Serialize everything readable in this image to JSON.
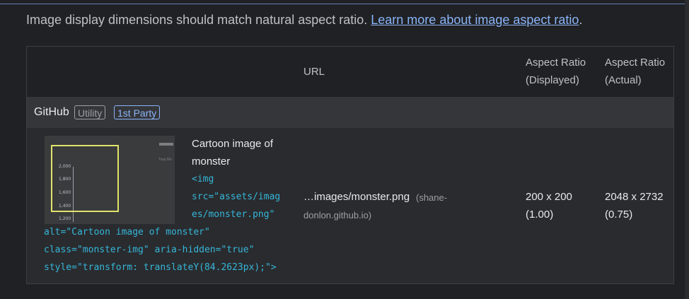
{
  "description": {
    "text": "Image display dimensions should match natural aspect ratio. ",
    "link": "Learn more about image aspect ratio",
    "suffix": "."
  },
  "table": {
    "headers": {
      "url": "URL",
      "displayed_line1": "Aspect Ratio",
      "displayed_line2": "(Displayed)",
      "actual_line1": "Aspect Ratio",
      "actual_line2": "(Actual)"
    },
    "group": {
      "entity": "GitHub",
      "badge_category": "Utility",
      "badge_party": "1st Party"
    },
    "rows": [
      {
        "thumbnail_ticks": [
          "2,000",
          "1,800",
          "1,600",
          "1,400",
          "1,200"
        ],
        "thumbnail_corner_text": "Total Mo",
        "node_label_line1": "Cartoon image of",
        "node_label_line2": "monster",
        "snippet": [
          "<img",
          "src=\"assets/imag",
          "es/monster.png\"",
          "alt=\"Cartoon image of monster\"",
          "class=\"monster-img\" aria-hidden=\"true\"",
          "style=\"transform: translateY(84.2623px);\">"
        ],
        "url_main": "…images/monster.png",
        "url_origin_line1": "(shane-",
        "url_origin_line2": "donlon.github.io)",
        "displayed_line1": "200 x 200",
        "displayed_line2": "(1.00)",
        "actual_line1": "2048 x 2732",
        "actual_line2": "(0.75)"
      }
    ]
  },
  "colors": {
    "background": "#202124",
    "link": "#8ab4f8",
    "code": "#35b6d9",
    "highlight": "#e1e36b"
  }
}
